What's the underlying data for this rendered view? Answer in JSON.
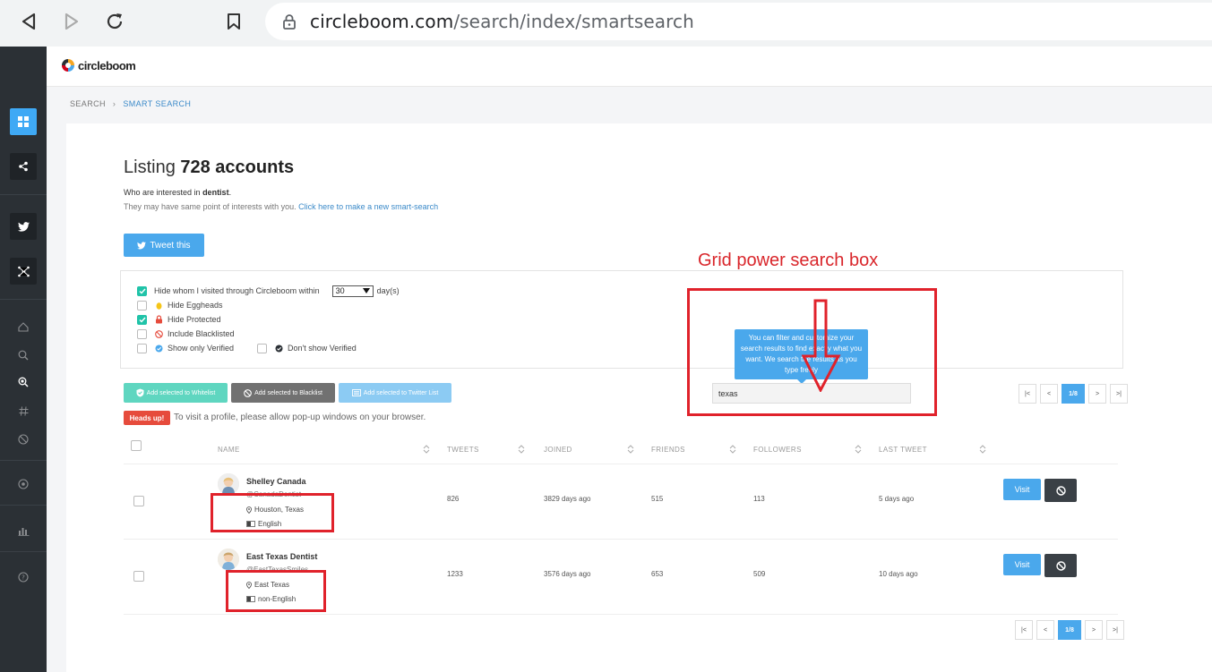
{
  "browser": {
    "url_host": "circleboom.com",
    "url_path": "/search/index/smartsearch"
  },
  "app": {
    "logo_text": "circleboom"
  },
  "breadcrumb": {
    "root": "SEARCH",
    "current": "SMART SEARCH"
  },
  "listing": {
    "prefix": "Listing",
    "count_label": "728 accounts",
    "interest_prefix": "Who are interested in",
    "interest_term": "dentist",
    "interest_suffix": ".",
    "note": "They may have same point of interests with you.",
    "new_search_link": "Click here to make a new smart-search"
  },
  "tweet_button": "Tweet this",
  "filters": {
    "visited_label": "Hide whom I visited through Circleboom within",
    "days_value": "30",
    "days_unit": "day(s)",
    "eggheads": "Hide Eggheads",
    "protected": "Hide Protected",
    "blacklisted": "Include Blacklisted",
    "only_verified": "Show only Verified",
    "dont_verified": "Don't show Verified"
  },
  "bulk_actions": {
    "whitelist": "Add selected to Whitelist",
    "blacklist": "Add selected to Blacklist",
    "twitter_list": "Add selected to Twitter List"
  },
  "grid_search": {
    "value": "texas",
    "tooltip": "You can filter and customize your search results to find exactly what you want. We search the results as you type freely"
  },
  "pagination": {
    "first": "|<",
    "prev": "<",
    "current": "1/8",
    "next": ">",
    "last": ">|"
  },
  "notice": {
    "badge": "Heads up!",
    "text": "To visit a profile, please allow pop-up windows on your browser."
  },
  "table": {
    "columns": [
      "NAME",
      "TWEETS",
      "JOINED",
      "FRIENDS",
      "FOLLOWERS",
      "LAST TWEET"
    ],
    "rows": [
      {
        "name": "Shelley Canada",
        "handle": "@CanadaDentist",
        "location": "Houston, Texas",
        "language": "English",
        "tweets": "826",
        "joined": "3829 days ago",
        "friends": "515",
        "followers": "113",
        "last_tweet": "5 days ago",
        "visit": "Visit"
      },
      {
        "name": "East Texas Dentist",
        "handle": "@EastTexasSmiles",
        "location": "East Texas",
        "language": "non-English",
        "tweets": "1233",
        "joined": "3576 days ago",
        "friends": "653",
        "followers": "509",
        "last_tweet": "10 days ago",
        "visit": "Visit"
      }
    ]
  },
  "annotation": {
    "label": "Grid power search box"
  },
  "colors": {
    "accent": "#4aa8ec",
    "sidebar": "#2b3035",
    "annotation_red": "#e0222b",
    "checkbox_on": "#20c3a8"
  }
}
